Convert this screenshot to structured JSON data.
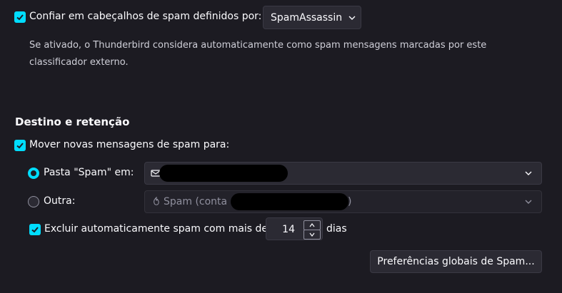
{
  "spam_headers": {
    "checkbox_label": "Confiar em cabeçalhos de spam definidos por:",
    "checked": true,
    "classifier_value": "SpamAssassin",
    "description": "Se ativado, o Thunderbird considera automaticamente como spam mensagens marcadas por este classificador externo."
  },
  "section": {
    "heading": "Destino e retenção"
  },
  "move_spam": {
    "checkbox_label": "Mover novas mensagens de spam para:",
    "checked": true
  },
  "spam_folder_option": {
    "label": "Pasta \"Spam\" em:",
    "selected": true
  },
  "other_option": {
    "label": "Outra:",
    "selected": false,
    "value": "Spam (conta",
    "value_suffix": ")"
  },
  "auto_delete": {
    "label": "Excluir automaticamente spam com mais de",
    "checked": true,
    "days_value": "14",
    "days_suffix": "dias"
  },
  "global_prefs_button": {
    "label": "Preferências globais de Spam..."
  },
  "colors": {
    "background": "#1c1b22",
    "accent": "#00ddff",
    "control": "#2b2a33"
  }
}
